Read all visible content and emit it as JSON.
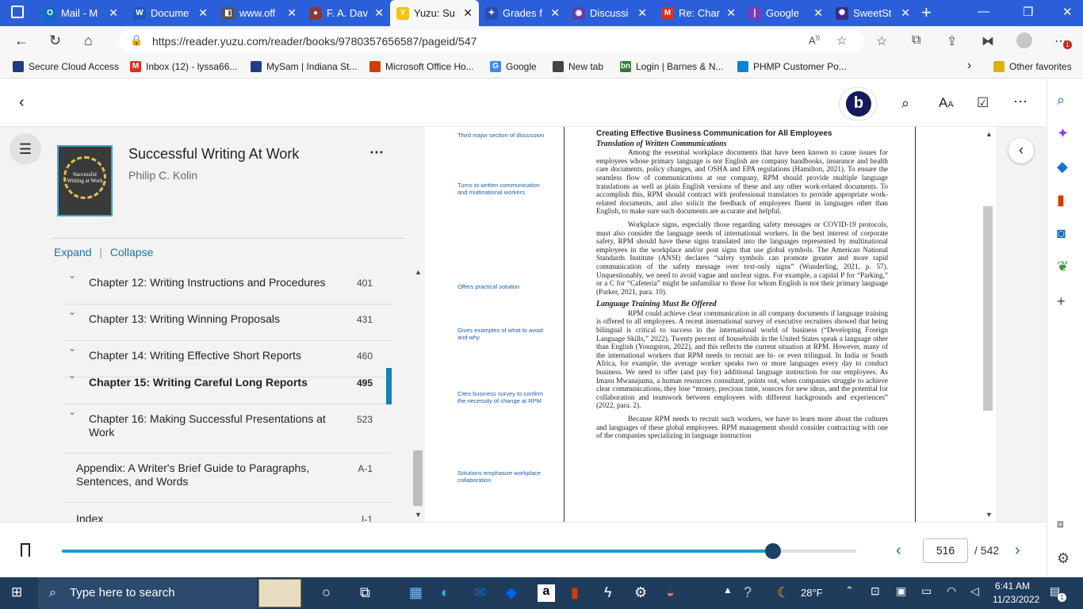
{
  "tabs": [
    {
      "title": "Mail - M",
      "color": "#0f6cbd",
      "glyph": "O"
    },
    {
      "title": "Docume",
      "color": "#185abd",
      "glyph": "W"
    },
    {
      "title": "www.off",
      "color": "#555555",
      "glyph": "◧"
    },
    {
      "title": "F. A. Dav",
      "color": "#8a3b2e",
      "glyph": "●"
    },
    {
      "title": "Yuzu: Su",
      "color": "#f5c400",
      "glyph": "Y",
      "active": true
    },
    {
      "title": "Grades f",
      "color": "#2a4db0",
      "glyph": "✦"
    },
    {
      "title": "Discussi",
      "color": "#5b3fa8",
      "glyph": "◉"
    },
    {
      "title": "Re: Char",
      "color": "#d93025",
      "glyph": "M"
    },
    {
      "title": "Google",
      "color": "#7a3cb8",
      "glyph": "❘"
    },
    {
      "title": "SweetSt",
      "color": "#3b2a8a",
      "glyph": "✺"
    }
  ],
  "address": {
    "url": "https://reader.yuzu.com/reader/books/9780357656587/pageid/547"
  },
  "bookmarks": [
    {
      "label": "Secure Cloud Access",
      "color": "#1f3c88"
    },
    {
      "label": "Inbox (12) - lyssa66...",
      "color": "#d93025",
      "glyph": "M"
    },
    {
      "label": "MySam | Indiana St...",
      "color": "#1f3c88"
    },
    {
      "label": "Microsoft Office Ho...",
      "color": "#d83b01"
    },
    {
      "label": "Google",
      "color": "#4285f4",
      "glyph": "G"
    },
    {
      "label": "New tab",
      "color": "#444444"
    },
    {
      "label": "Login | Barnes & N...",
      "color": "#2e7d32",
      "glyph": "bn"
    },
    {
      "label": "PHMP Customer Po...",
      "color": "#0a84d6"
    },
    {
      "label": "Other favorites",
      "color": "#e0b000"
    }
  ],
  "book": {
    "title": "Successful Writing At Work",
    "author": "Philip C. Kolin",
    "cover_text": "Successful Writing at Work"
  },
  "toc": {
    "expand": "Expand",
    "separator": "|",
    "collapse": "Collapse",
    "items": [
      {
        "label": "Chapter 12: Writing Instructions and Procedures",
        "page": "401"
      },
      {
        "label": "Chapter 13: Writing Winning Proposals",
        "page": "431"
      },
      {
        "label": "Chapter 14: Writing Effective Short Reports",
        "page": "460"
      },
      {
        "label": "Chapter 15: Writing Careful Long Reports",
        "page": "495",
        "active": true
      },
      {
        "label": "Chapter 16: Making Successful Presentations at Work",
        "page": "523"
      },
      {
        "label": "Appendix: A Writer's Brief Guide to Paragraphs, Sentences, and Words",
        "page": "A-1"
      },
      {
        "label": "Index",
        "page": "I-1"
      }
    ]
  },
  "page": {
    "notes": [
      "Third major section of discussion",
      "Turns to written communication and multinational workers",
      "Offers practical solution",
      "Gives examples of what to avoid and why",
      "Cites business survey to confirm the necessity of change at RPM",
      "Solutions emphasize workplace collaboration"
    ],
    "heading": "Creating Effective Business Communication for All Employees",
    "sub1": "Translation of Written Communications",
    "p1": "Among the essential workplace documents that have been known to cause issues for employees whose primary language is not English are company handbooks, insurance and health care documents, policy changes, and OSHA and EPA regulations (Hamilton, 2021). To ensure the seamless flow of communications at our company, RPM should provide multiple language translations as well as plain English versions of these and any other work-related documents. To accomplish this, RPM should contract with professional translators to provide appropriate work-related documents, and also solicit the feedback of employees fluent in languages other than English, to make sure such documents are accurate and helpful.",
    "p2": "Workplace signs, especially those regarding safety messages or COVID-19 protocols, must also consider the language needs of international workers. In the best interest of corporate safety, RPM should have these signs translated into the languages represented by multinational employees in the workplace and/or post signs that use global symbols. The American National Standards Institute (ANSI) declares “safety symbols can promote greater and more rapid communication of the safety message over text-only signs” (Wunderling, 2021, p. 57). Unquestionably, we need to avoid vague and unclear signs. For example, a capital P for “Parking,” or a C for “Cafeteria” might be unfamiliar to those for whom English is not their primary language (Parker, 2021, para. 10).",
    "sub2": "Language Training Must Be Offered",
    "p3": "RPM could achieve clear communication in all company documents if language training is offered to all employees. A recent international survey of executive recruiters showed that being bilingual is critical to success in the international world of business (“Developing Foreign Language Skills,” 2022). Twenty percent of households in the United States speak a language other than English (Youngston, 2022), and this reflects the current situation at RPM. However, many of the international workers that RPM needs to recruit are bi- or even trilingual. In India or South Africa, for example, the average worker speaks two or more languages every day to conduct business. We need to offer (and pay for) additional language instruction for our employees. As Imasu Mwanajuma, a human resources consultant, points out, when companies struggle to achieve clear communications, they lose “money, precious time, sources for new ideas, and the potential for collaboration and teamwork between employees with different backgrounds and experiences” (2022, para. 2).",
    "p4": "Because RPM needs to recruit such workers, we have to learn more about the cultures and languages of these global employees. RPM management should consider contracting with one of the companies specializing in language instruction"
  },
  "pager": {
    "current": "516",
    "total": "/ 542",
    "progress": 0.952
  },
  "taskbar": {
    "search_placeholder": "Type here to search",
    "temp": "28°F",
    "time": "6:41 AM",
    "date": "11/23/2022",
    "notif": "1"
  }
}
